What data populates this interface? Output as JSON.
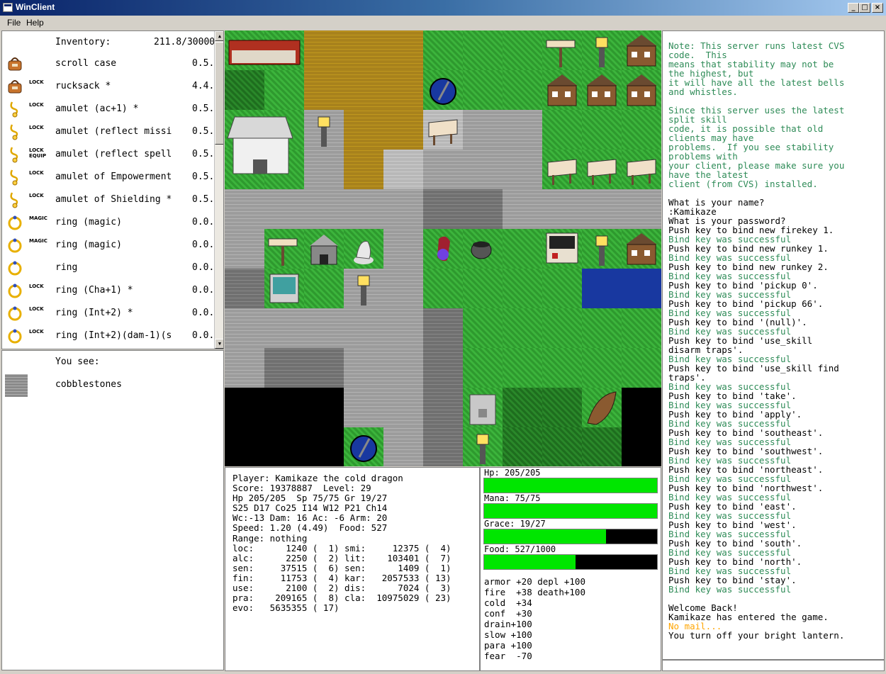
{
  "window": {
    "title": "WinClient",
    "btn_min": "_",
    "btn_max": "□",
    "btn_close": "×"
  },
  "menu": {
    "file": "File",
    "help": "Help"
  },
  "inventory": {
    "header": "Inventory:",
    "total_weight": "211.8/30000",
    "items": [
      {
        "name": "scroll case",
        "weight": "0.5.",
        "tag": "",
        "icon": "bag-icon"
      },
      {
        "name": "rucksack *",
        "weight": "4.4.",
        "tag": "LOCK",
        "icon": "bag-icon"
      },
      {
        "name": "amulet (ac+1) *",
        "weight": "0.5.",
        "tag": "LOCK",
        "icon": "amulet-icon"
      },
      {
        "name": "amulet (reflect missi",
        "weight": "0.5.",
        "tag": "LOCK",
        "icon": "amulet-icon"
      },
      {
        "name": "amulet (reflect spell",
        "weight": "0.5.",
        "tag": "LOCK EQUIP",
        "icon": "amulet-icon"
      },
      {
        "name": "amulet of Empowerment",
        "weight": "0.5.",
        "tag": "LOCK",
        "icon": "amulet-icon"
      },
      {
        "name": "amulet of Shielding *",
        "weight": "0.5.",
        "tag": "LOCK",
        "icon": "amulet-icon"
      },
      {
        "name": "ring (magic)",
        "weight": "0.0.",
        "tag": "MAGIC",
        "icon": "ring-icon"
      },
      {
        "name": "ring (magic)",
        "weight": "0.0.",
        "tag": "MAGIC",
        "icon": "ring-icon"
      },
      {
        "name": "ring",
        "weight": "0.0.",
        "tag": "",
        "icon": "ring-icon"
      },
      {
        "name": "ring (Cha+1) *",
        "weight": "0.0.",
        "tag": "LOCK",
        "icon": "ring-icon"
      },
      {
        "name": "ring (Int+2) *",
        "weight": "0.0.",
        "tag": "LOCK",
        "icon": "ring-icon"
      },
      {
        "name": "ring (Int+2)(dam-1)(s",
        "weight": "0.0.",
        "tag": "LOCK",
        "icon": "ring-icon"
      }
    ]
  },
  "look": {
    "header": "You see:",
    "item": "cobblestones",
    "icon": "cobblestone-icon"
  },
  "stats": {
    "lines": [
      "Player: Kamikaze the cold dragon",
      "Score: 19378887  Level: 29",
      "Hp 205/205  Sp 75/75 Gr 19/27",
      "S25 D17 Co25 I14 W12 P21 Ch14",
      "Wc:-13 Dam: 16 Ac: -6 Arm: 20",
      "Speed: 1.20 (4.49)  Food: 527",
      "Range: nothing",
      "loc:      1240 (  1) smi:     12375 (  4)",
      "alc:      2250 (  2) lit:    103401 (  7)",
      "sen:     37515 (  6) sen:      1409 (  1)",
      "fin:     11753 (  4) kar:   2057533 ( 13)",
      "use:      2100 (  2) dis:      7024 (  3)",
      "pra:    209165 (  8) cla:  10975029 ( 23)",
      "evo:   5635355 ( 17)"
    ]
  },
  "bars": [
    {
      "label": "Hp: 205/205",
      "fraction": 1.0
    },
    {
      "label": "Mana: 75/75",
      "fraction": 1.0
    },
    {
      "label": "Grace: 19/27",
      "fraction": 0.7037
    },
    {
      "label": "Food: 527/1000",
      "fraction": 0.527
    }
  ],
  "bar_color": "#00e600",
  "resists": [
    "armor +20 depl +100",
    "fire  +38 death+100",
    "cold  +34",
    "conf  +30",
    "drain+100",
    "slow +100",
    "para +100",
    "fear  -70"
  ],
  "messages": [
    {
      "t": "Note: This server runs latest CVS",
      "c": "g"
    },
    {
      "t": "code.  This",
      "c": "g"
    },
    {
      "t": "means that stability may not be",
      "c": "g"
    },
    {
      "t": "the highest, but",
      "c": "g"
    },
    {
      "t": "it will have all the latest bells",
      "c": "g"
    },
    {
      "t": "and whistles.",
      "c": "g"
    },
    {
      "t": "",
      "c": "g"
    },
    {
      "t": "Since this server uses the latest",
      "c": "g"
    },
    {
      "t": "split skill",
      "c": "g"
    },
    {
      "t": "code, it is possible that old",
      "c": "g"
    },
    {
      "t": "clients may have",
      "c": "g"
    },
    {
      "t": "problems.  If you see stability",
      "c": "g"
    },
    {
      "t": "problems with",
      "c": "g"
    },
    {
      "t": "your client, please make sure you",
      "c": "g"
    },
    {
      "t": "have the latest",
      "c": "g"
    },
    {
      "t": "client (from CVS) installed.",
      "c": "g"
    },
    {
      "t": "",
      "c": "b"
    },
    {
      "t": "What is your name?",
      "c": "b"
    },
    {
      "t": ":Kamikaze",
      "c": "b"
    },
    {
      "t": "What is your password?",
      "c": "b"
    },
    {
      "t": "Push key to bind new firekey 1.",
      "c": "b"
    },
    {
      "t": "Bind key was successful",
      "c": "g"
    },
    {
      "t": "Push key to bind new runkey 1.",
      "c": "b"
    },
    {
      "t": "Bind key was successful",
      "c": "g"
    },
    {
      "t": "Push key to bind new runkey 2.",
      "c": "b"
    },
    {
      "t": "Bind key was successful",
      "c": "g"
    },
    {
      "t": "Push key to bind 'pickup 0'.",
      "c": "b"
    },
    {
      "t": "Bind key was successful",
      "c": "g"
    },
    {
      "t": "Push key to bind 'pickup 66'.",
      "c": "b"
    },
    {
      "t": "Bind key was successful",
      "c": "g"
    },
    {
      "t": "Push key to bind '(null)'.",
      "c": "b"
    },
    {
      "t": "Bind key was successful",
      "c": "g"
    },
    {
      "t": "Push key to bind 'use_skill",
      "c": "b"
    },
    {
      "t": "disarm traps'.",
      "c": "b"
    },
    {
      "t": "Bind key was successful",
      "c": "g"
    },
    {
      "t": "Push key to bind 'use_skill find",
      "c": "b"
    },
    {
      "t": "traps'.",
      "c": "b"
    },
    {
      "t": "Bind key was successful",
      "c": "g"
    },
    {
      "t": "Push key to bind 'take'.",
      "c": "b"
    },
    {
      "t": "Bind key was successful",
      "c": "g"
    },
    {
      "t": "Push key to bind 'apply'.",
      "c": "b"
    },
    {
      "t": "Bind key was successful",
      "c": "g"
    },
    {
      "t": "Push key to bind 'southeast'.",
      "c": "b"
    },
    {
      "t": "Bind key was successful",
      "c": "g"
    },
    {
      "t": "Push key to bind 'southwest'.",
      "c": "b"
    },
    {
      "t": "Bind key was successful",
      "c": "g"
    },
    {
      "t": "Push key to bind 'northeast'.",
      "c": "b"
    },
    {
      "t": "Bind key was successful",
      "c": "g"
    },
    {
      "t": "Push key to bind 'northwest'.",
      "c": "b"
    },
    {
      "t": "Bind key was successful",
      "c": "g"
    },
    {
      "t": "Push key to bind 'east'.",
      "c": "b"
    },
    {
      "t": "Bind key was successful",
      "c": "g"
    },
    {
      "t": "Push key to bind 'west'.",
      "c": "b"
    },
    {
      "t": "Bind key was successful",
      "c": "g"
    },
    {
      "t": "Push key to bind 'south'.",
      "c": "b"
    },
    {
      "t": "Bind key was successful",
      "c": "g"
    },
    {
      "t": "Push key to bind 'north'.",
      "c": "b"
    },
    {
      "t": "Bind key was successful",
      "c": "g"
    },
    {
      "t": "Push key to bind 'stay'.",
      "c": "b"
    },
    {
      "t": "Bind key was successful",
      "c": "g"
    },
    {
      "t": "",
      "c": "b"
    },
    {
      "t": "Welcome Back!",
      "c": "b"
    },
    {
      "t": "Kamikaze has entered the game.",
      "c": "b"
    },
    {
      "t": "No mail...",
      "c": "o"
    },
    {
      "t": "You turn off your bright lantern.",
      "c": "b"
    }
  ],
  "colors": {
    "msg_green": "#2e8b57",
    "msg_orange": "#ffa500"
  },
  "map": {
    "rows": [
      "g g y y y g g g g g g",
      "dg g y y y g g g g g g",
      "g g c y y lc c c g g g",
      "g g c y lc c c c g g g",
      "c c c c c dc dc c c c c",
      "c g g g c g g g g g g",
      "dc g g c c g g g g w w",
      "c c c c c dc g g g g g",
      "c dc dc c c dc g g g g g",
      "k k k c c dc g dg dg g k",
      "k k k g c dc g dg dg dg k"
    ],
    "objects": [
      {
        "type": "house-red",
        "col": 0,
        "row": 0
      },
      {
        "type": "sign",
        "col": 8,
        "row": 0
      },
      {
        "type": "lamp",
        "col": 9,
        "row": 0
      },
      {
        "type": "house",
        "col": 10,
        "row": 0
      },
      {
        "type": "orb",
        "col": 5,
        "row": 1
      },
      {
        "type": "house",
        "col": 8,
        "row": 1
      },
      {
        "type": "house",
        "col": 9,
        "row": 1
      },
      {
        "type": "house",
        "col": 10,
        "row": 1
      },
      {
        "type": "temple",
        "col": 0,
        "row": 2
      },
      {
        "type": "lamp",
        "col": 2,
        "row": 2
      },
      {
        "type": "plaque",
        "col": 5,
        "row": 2
      },
      {
        "type": "plaque",
        "col": 8,
        "row": 3
      },
      {
        "type": "plaque",
        "col": 9,
        "row": 3
      },
      {
        "type": "plaque",
        "col": 10,
        "row": 3
      },
      {
        "type": "sign",
        "col": 1,
        "row": 5
      },
      {
        "type": "hut",
        "col": 2,
        "row": 5
      },
      {
        "type": "statue",
        "col": 3,
        "row": 5
      },
      {
        "type": "player",
        "col": 5,
        "row": 5
      },
      {
        "type": "cauldron",
        "col": 6,
        "row": 5
      },
      {
        "type": "shop",
        "col": 8,
        "row": 5
      },
      {
        "type": "lamp",
        "col": 9,
        "row": 5
      },
      {
        "type": "house",
        "col": 10,
        "row": 5
      },
      {
        "type": "house-teal",
        "col": 1,
        "row": 6
      },
      {
        "type": "lamp",
        "col": 3,
        "row": 6
      },
      {
        "type": "tower",
        "col": 6,
        "row": 9
      },
      {
        "type": "lamp",
        "col": 6,
        "row": 10
      },
      {
        "type": "orb",
        "col": 3,
        "row": 10
      },
      {
        "type": "boat",
        "col": 9,
        "row": 9
      }
    ]
  }
}
